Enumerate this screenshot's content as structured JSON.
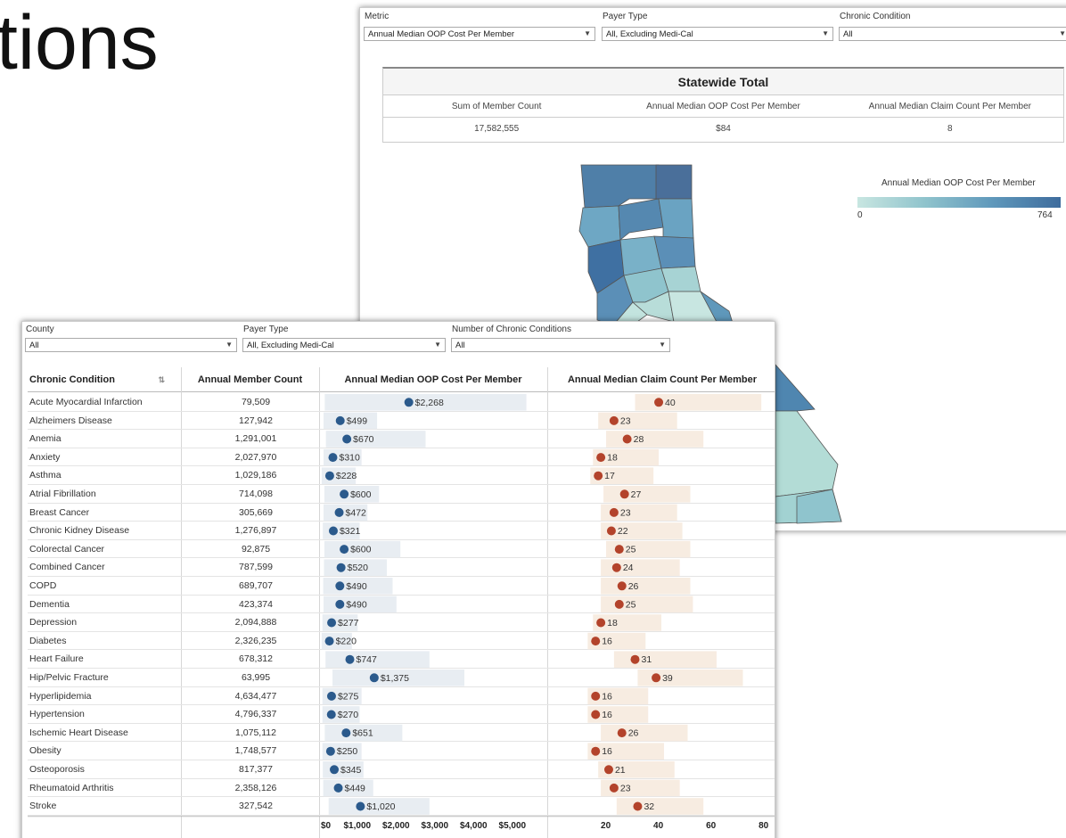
{
  "slide_title": "tions",
  "map_panel": {
    "filters": [
      {
        "label": "Metric",
        "value": "Annual Median OOP Cost Per Member"
      },
      {
        "label": "Payer Type",
        "value": "All, Excluding Medi-Cal"
      },
      {
        "label": "Chronic Condition",
        "value": "All"
      }
    ],
    "statewide": {
      "title": "Statewide Total",
      "headers": [
        "Sum of Member Count",
        "Annual Median OOP Cost Per Member",
        "Annual Median Claim Count Per Member"
      ],
      "values": [
        "17,582,555",
        "$84",
        "8"
      ]
    },
    "legend": {
      "title": "Annual Median OOP Cost Per Member",
      "min": "0",
      "max": "764",
      "colors": [
        "#c8e6e1",
        "#8fc3cc",
        "#5f98bb",
        "#3e6c9d"
      ]
    }
  },
  "table_panel": {
    "filters": [
      {
        "label": "County",
        "value": "All"
      },
      {
        "label": "Payer Type",
        "value": "All, Excluding Medi-Cal"
      },
      {
        "label": "Number of Chronic Conditions",
        "value": "All"
      }
    ],
    "headers": {
      "condition": "Chronic Condition",
      "member_count": "Annual Member Count",
      "oop": "Annual Median OOP Cost Per Member",
      "claims": "Annual Median Claim Count Per Member"
    },
    "sort_icon": "sort-icon",
    "oop_axis": [
      "$0",
      "$1,000",
      "$2,000",
      "$3,000",
      "$4,000",
      "$5,000"
    ],
    "claims_axis": [
      "20",
      "40",
      "60",
      "80"
    ],
    "colors": {
      "oop_dot": "#2b5a8c",
      "oop_band": "#e8edf2",
      "claims_dot": "#b3432b",
      "claims_band": "#f7ece1"
    }
  },
  "chart_data": {
    "type": "scatter",
    "categories": [
      "Acute Myocardial Infarction",
      "Alzheimers Disease",
      "Anemia",
      "Anxiety",
      "Asthma",
      "Atrial Fibrillation",
      "Breast Cancer",
      "Chronic Kidney Disease",
      "Colorectal Cancer",
      "Combined Cancer",
      "COPD",
      "Dementia",
      "Depression",
      "Diabetes",
      "Heart Failure",
      "Hip/Pelvic Fracture",
      "Hyperlipidemia",
      "Hypertension",
      "Ischemic Heart Disease",
      "Obesity",
      "Osteoporosis",
      "Rheumatoid Arthritis",
      "Stroke"
    ],
    "member_counts": [
      "79,509",
      "127,942",
      "1,291,001",
      "2,027,970",
      "1,029,186",
      "714,098",
      "305,669",
      "1,276,897",
      "92,875",
      "787,599",
      "689,707",
      "423,374",
      "2,094,888",
      "2,326,235",
      "678,312",
      "63,995",
      "4,634,477",
      "4,796,337",
      "1,075,112",
      "1,748,577",
      "817,377",
      "2,358,126",
      "327,542"
    ],
    "series": [
      {
        "name": "Annual Median OOP Cost Per Member",
        "values": [
          2268,
          499,
          670,
          310,
          228,
          600,
          472,
          321,
          600,
          520,
          490,
          490,
          277,
          220,
          747,
          1375,
          275,
          270,
          651,
          250,
          345,
          449,
          1020
        ],
        "labels": [
          "$2,268",
          "$499",
          "$670",
          "$310",
          "$228",
          "$600",
          "$472",
          "$321",
          "$600",
          "$520",
          "$490",
          "$490",
          "$277",
          "$220",
          "$747",
          "$1,375",
          "$275",
          "$270",
          "$651",
          "$250",
          "$345",
          "$449",
          "$1,020"
        ],
        "band_low": [
          100,
          70,
          130,
          70,
          20,
          90,
          70,
          50,
          90,
          80,
          60,
          70,
          40,
          20,
          120,
          300,
          40,
          40,
          100,
          40,
          50,
          60,
          200
        ],
        "band_high": [
          5300,
          1450,
          2700,
          1050,
          900,
          1500,
          1200,
          1000,
          2050,
          1700,
          1850,
          1950,
          950,
          800,
          2800,
          3700,
          1050,
          1000,
          2100,
          1050,
          1100,
          1350,
          2800
        ]
      },
      {
        "name": "Annual Median Claim Count Per Member",
        "values": [
          40,
          23,
          28,
          18,
          17,
          27,
          23,
          22,
          25,
          24,
          26,
          25,
          18,
          16,
          31,
          39,
          16,
          16,
          26,
          16,
          21,
          23,
          32
        ],
        "band_low": [
          31,
          17,
          20,
          15,
          14,
          19,
          18,
          18,
          20,
          18,
          18,
          18,
          15,
          13,
          23,
          32,
          13,
          13,
          18,
          13,
          17,
          18,
          24
        ],
        "band_high": [
          79,
          47,
          57,
          40,
          38,
          52,
          47,
          49,
          52,
          48,
          52,
          53,
          41,
          35,
          62,
          72,
          36,
          36,
          51,
          42,
          46,
          48,
          57
        ]
      }
    ],
    "xlim_oop": [
      0,
      5700
    ],
    "xlim_claims": [
      0,
      82
    ]
  }
}
